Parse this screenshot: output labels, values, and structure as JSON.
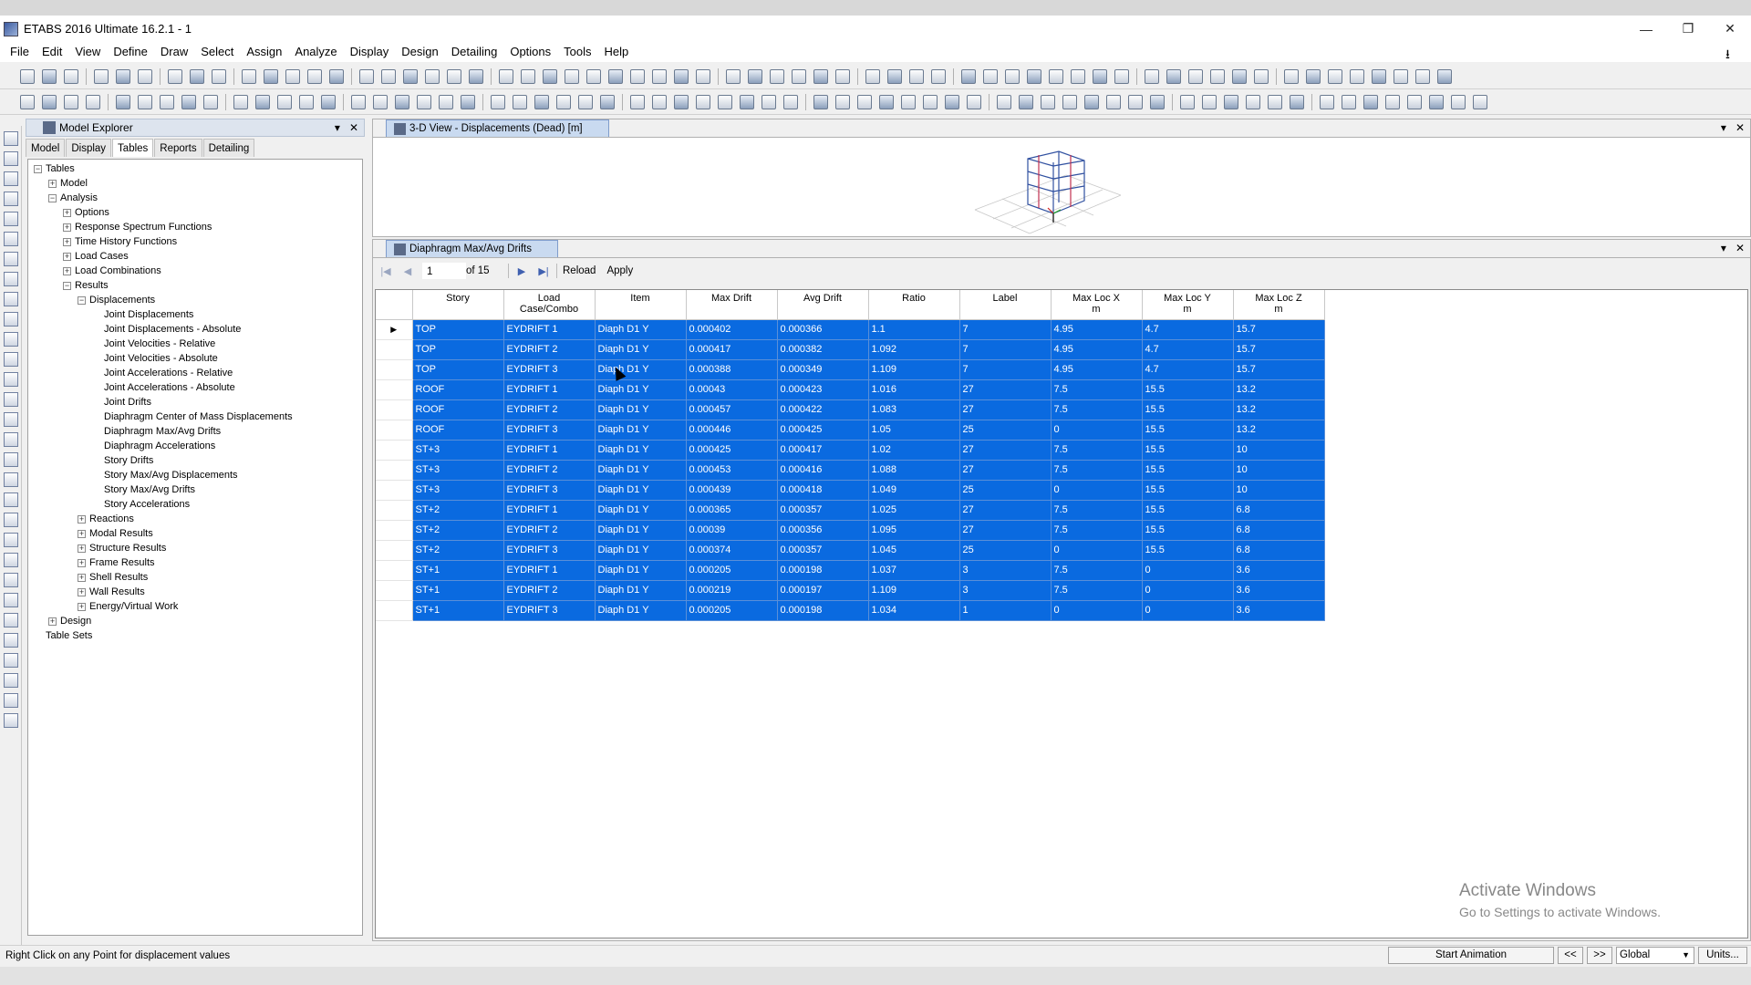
{
  "app": {
    "title": "ETABS 2016 Ultimate 16.2.1 - 1",
    "controls": {
      "minimize": "—",
      "restore": "❐",
      "close": "✕"
    }
  },
  "menu": [
    "File",
    "Edit",
    "View",
    "Define",
    "Draw",
    "Select",
    "Assign",
    "Analyze",
    "Display",
    "Design",
    "Detailing",
    "Options",
    "Tools",
    "Help"
  ],
  "explorer": {
    "title": "Model Explorer",
    "tabs": [
      "Model",
      "Display",
      "Tables",
      "Reports",
      "Detailing"
    ],
    "active_tab": "Tables",
    "tree": [
      {
        "label": "Tables",
        "level": 0,
        "toggle": "−"
      },
      {
        "label": "Model",
        "level": 1,
        "toggle": "+"
      },
      {
        "label": "Analysis",
        "level": 1,
        "toggle": "−"
      },
      {
        "label": "Options",
        "level": 2,
        "toggle": "+"
      },
      {
        "label": "Response Spectrum Functions",
        "level": 2,
        "toggle": "+"
      },
      {
        "label": "Time History Functions",
        "level": 2,
        "toggle": "+"
      },
      {
        "label": "Load Cases",
        "level": 2,
        "toggle": "+"
      },
      {
        "label": "Load Combinations",
        "level": 2,
        "toggle": "+"
      },
      {
        "label": "Results",
        "level": 2,
        "toggle": "−"
      },
      {
        "label": "Displacements",
        "level": 3,
        "toggle": "−"
      },
      {
        "label": "Joint Displacements",
        "level": 4,
        "toggle": ""
      },
      {
        "label": "Joint Displacements - Absolute",
        "level": 4,
        "toggle": ""
      },
      {
        "label": "Joint Velocities - Relative",
        "level": 4,
        "toggle": ""
      },
      {
        "label": "Joint Velocities - Absolute",
        "level": 4,
        "toggle": ""
      },
      {
        "label": "Joint Accelerations - Relative",
        "level": 4,
        "toggle": ""
      },
      {
        "label": "Joint Accelerations - Absolute",
        "level": 4,
        "toggle": ""
      },
      {
        "label": "Joint Drifts",
        "level": 4,
        "toggle": ""
      },
      {
        "label": "Diaphragm Center of Mass Displacements",
        "level": 4,
        "toggle": ""
      },
      {
        "label": "Diaphragm Max/Avg Drifts",
        "level": 4,
        "toggle": ""
      },
      {
        "label": "Diaphragm Accelerations",
        "level": 4,
        "toggle": ""
      },
      {
        "label": "Story Drifts",
        "level": 4,
        "toggle": ""
      },
      {
        "label": "Story Max/Avg Displacements",
        "level": 4,
        "toggle": ""
      },
      {
        "label": "Story Max/Avg Drifts",
        "level": 4,
        "toggle": ""
      },
      {
        "label": "Story Accelerations",
        "level": 4,
        "toggle": ""
      },
      {
        "label": "Reactions",
        "level": 3,
        "toggle": "+"
      },
      {
        "label": "Modal Results",
        "level": 3,
        "toggle": "+"
      },
      {
        "label": "Structure Results",
        "level": 3,
        "toggle": "+"
      },
      {
        "label": "Frame Results",
        "level": 3,
        "toggle": "+"
      },
      {
        "label": "Shell Results",
        "level": 3,
        "toggle": "+"
      },
      {
        "label": "Wall Results",
        "level": 3,
        "toggle": "+"
      },
      {
        "label": "Energy/Virtual Work",
        "level": 3,
        "toggle": "+"
      },
      {
        "label": "Design",
        "level": 1,
        "toggle": "+"
      },
      {
        "label": "Table Sets",
        "level": 0,
        "toggle": ""
      }
    ]
  },
  "view3d": {
    "tab_label": "3-D View  - Displacements (Dead)  [m]"
  },
  "table_panel": {
    "tab_label": "Diaphragm Max/Avg Drifts",
    "nav": {
      "first": "|◀",
      "prev": "◀",
      "page": "1",
      "of": "of 15",
      "next": "▶",
      "last": "▶|",
      "reload": "Reload",
      "apply": "Apply"
    },
    "columns": [
      {
        "line1": "Story",
        "line2": ""
      },
      {
        "line1": "Load",
        "line2": "Case/Combo"
      },
      {
        "line1": "Item",
        "line2": ""
      },
      {
        "line1": "Max Drift",
        "line2": ""
      },
      {
        "line1": "Avg Drift",
        "line2": ""
      },
      {
        "line1": "Ratio",
        "line2": ""
      },
      {
        "line1": "Label",
        "line2": ""
      },
      {
        "line1": "Max Loc X",
        "line2": "m"
      },
      {
        "line1": "Max Loc Y",
        "line2": "m"
      },
      {
        "line1": "Max Loc Z",
        "line2": "m"
      }
    ],
    "current_row_marker": "▶",
    "rows": [
      [
        "TOP",
        "EYDRIFT 1",
        "Diaph D1 Y",
        "0.000402",
        "0.000366",
        "1.1",
        "7",
        "4.95",
        "4.7",
        "15.7"
      ],
      [
        "TOP",
        "EYDRIFT 2",
        "Diaph D1 Y",
        "0.000417",
        "0.000382",
        "1.092",
        "7",
        "4.95",
        "4.7",
        "15.7"
      ],
      [
        "TOP",
        "EYDRIFT 3",
        "Diaph D1 Y",
        "0.000388",
        "0.000349",
        "1.109",
        "7",
        "4.95",
        "4.7",
        "15.7"
      ],
      [
        "ROOF",
        "EYDRIFT 1",
        "Diaph D1 Y",
        "0.00043",
        "0.000423",
        "1.016",
        "27",
        "7.5",
        "15.5",
        "13.2"
      ],
      [
        "ROOF",
        "EYDRIFT 2",
        "Diaph D1 Y",
        "0.000457",
        "0.000422",
        "1.083",
        "27",
        "7.5",
        "15.5",
        "13.2"
      ],
      [
        "ROOF",
        "EYDRIFT 3",
        "Diaph D1 Y",
        "0.000446",
        "0.000425",
        "1.05",
        "25",
        "0",
        "15.5",
        "13.2"
      ],
      [
        "ST+3",
        "EYDRIFT 1",
        "Diaph D1 Y",
        "0.000425",
        "0.000417",
        "1.02",
        "27",
        "7.5",
        "15.5",
        "10"
      ],
      [
        "ST+3",
        "EYDRIFT 2",
        "Diaph D1 Y",
        "0.000453",
        "0.000416",
        "1.088",
        "27",
        "7.5",
        "15.5",
        "10"
      ],
      [
        "ST+3",
        "EYDRIFT 3",
        "Diaph D1 Y",
        "0.000439",
        "0.000418",
        "1.049",
        "25",
        "0",
        "15.5",
        "10"
      ],
      [
        "ST+2",
        "EYDRIFT 1",
        "Diaph D1 Y",
        "0.000365",
        "0.000357",
        "1.025",
        "27",
        "7.5",
        "15.5",
        "6.8"
      ],
      [
        "ST+2",
        "EYDRIFT 2",
        "Diaph D1 Y",
        "0.00039",
        "0.000356",
        "1.095",
        "27",
        "7.5",
        "15.5",
        "6.8"
      ],
      [
        "ST+2",
        "EYDRIFT 3",
        "Diaph D1 Y",
        "0.000374",
        "0.000357",
        "1.045",
        "25",
        "0",
        "15.5",
        "6.8"
      ],
      [
        "ST+1",
        "EYDRIFT 1",
        "Diaph D1 Y",
        "0.000205",
        "0.000198",
        "1.037",
        "3",
        "7.5",
        "0",
        "3.6"
      ],
      [
        "ST+1",
        "EYDRIFT 2",
        "Diaph D1 Y",
        "0.000219",
        "0.000197",
        "1.109",
        "3",
        "7.5",
        "0",
        "3.6"
      ],
      [
        "ST+1",
        "EYDRIFT 3",
        "Diaph D1 Y",
        "0.000205",
        "0.000198",
        "1.034",
        "1",
        "0",
        "0",
        "3.6"
      ]
    ],
    "selection_color": "#0a6ae0"
  },
  "watermark": {
    "line1": "Activate Windows",
    "line2": "Go to Settings to activate Windows."
  },
  "status": {
    "text": "Right Click on any Point for displacement values",
    "start_animation": "Start Animation",
    "prev": "<<",
    "next": ">>",
    "coord_system": "Global",
    "units": "Units..."
  }
}
